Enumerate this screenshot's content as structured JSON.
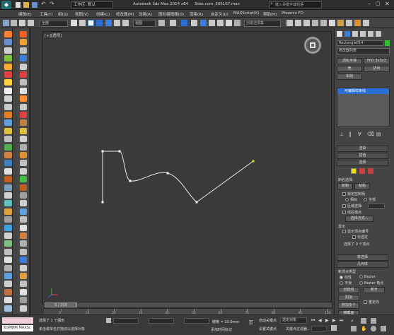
{
  "title": {
    "workspace_label": "工作区: 默认",
    "app_title": "Autodesk 3ds Max 2014 x64",
    "file_name": "3dsk.com_305107.max",
    "search_placeholder": "键入关键字或短语"
  },
  "menu": [
    "编辑(E)",
    "工具(T)",
    "组(G)",
    "视图(V)",
    "创建(C)",
    "修改器(M)",
    "动画(A)",
    "图形编辑器(D)",
    "渲染(R)",
    "自定义(U)",
    "MAXScript(X)",
    "帮助(H)",
    "Phoenix FD"
  ],
  "toolbar": {
    "filter_value": "全部",
    "view_value": "视图",
    "selection_set_placeholder": "创建选择集"
  },
  "viewport": {
    "label": "[+][透视]"
  },
  "spline": {
    "points": [
      [
        145,
        214
      ],
      [
        169,
        214
      ],
      [
        184,
        256
      ],
      [
        237,
        245
      ],
      [
        278,
        286
      ],
      [
        358,
        228
      ],
      [
        145,
        286
      ]
    ]
  },
  "right_panel": {
    "object_name": "Rectangle014",
    "modifier_list": "修改器列表",
    "btn_turbosmooth": "涡轮平滑",
    "btn_ffd": "FFD 3x3x3",
    "btn_shell": "壳",
    "btn_extrude": "挤出",
    "btn_lathe": "车削",
    "stack_item": "可编辑样条线",
    "rollout_render": "渲染",
    "rollout_interp": "插值",
    "rollout_select": "选择",
    "named_sel": "命名选择:",
    "btn_copy": "复制",
    "btn_paste": "粘贴",
    "lock_handles": "锁定控制柄",
    "opt_similar": "相似",
    "opt_all": "全部",
    "area_select": "区域选择:",
    "seg_end": "线段端点",
    "select_by": "选择方式...",
    "display": "显示",
    "show_vertex_num": "显示顶点编号",
    "only_selected": "仅选定",
    "selected_count": "选择了 0 个顶点",
    "rollout_soft": "软选择",
    "rollout_geom": "几何体",
    "new_vertex_type": "新顶点类型",
    "opt_linear": "线性",
    "opt_bezier": "Bezier",
    "opt_smooth": "平滑",
    "opt_bezier_corner": "Bezier 角点",
    "btn_create_line": "创建线",
    "btn_break": "断开",
    "btn_attach": "附加",
    "btn_attach_multi": "附加多个",
    "reorient": "重定向",
    "btn_cross_section": "横截面"
  },
  "bottom": {
    "frame_counter": "0 / 100",
    "status_selected": "选择了 1 个图形",
    "status_hint": "单击或单击并拖动以选择对象",
    "grid": "栅格 = 10.0mm",
    "auto_key": "自动关键点",
    "set_key": "设置关键点",
    "selected_dropdown": "选定对象",
    "key_filters": "关键点过滤器...",
    "add_time_tag": "添加时间标记",
    "welcome": "欢迎使用 MAXSc",
    "ticks": [
      "0",
      "10",
      "20",
      "30",
      "40",
      "50",
      "60",
      "70",
      "80",
      "90",
      "100"
    ]
  },
  "colors": {
    "spline": "#e8e8e8",
    "selected_vertex": "#e8e020",
    "accent_blue": "#2a6fd6"
  }
}
